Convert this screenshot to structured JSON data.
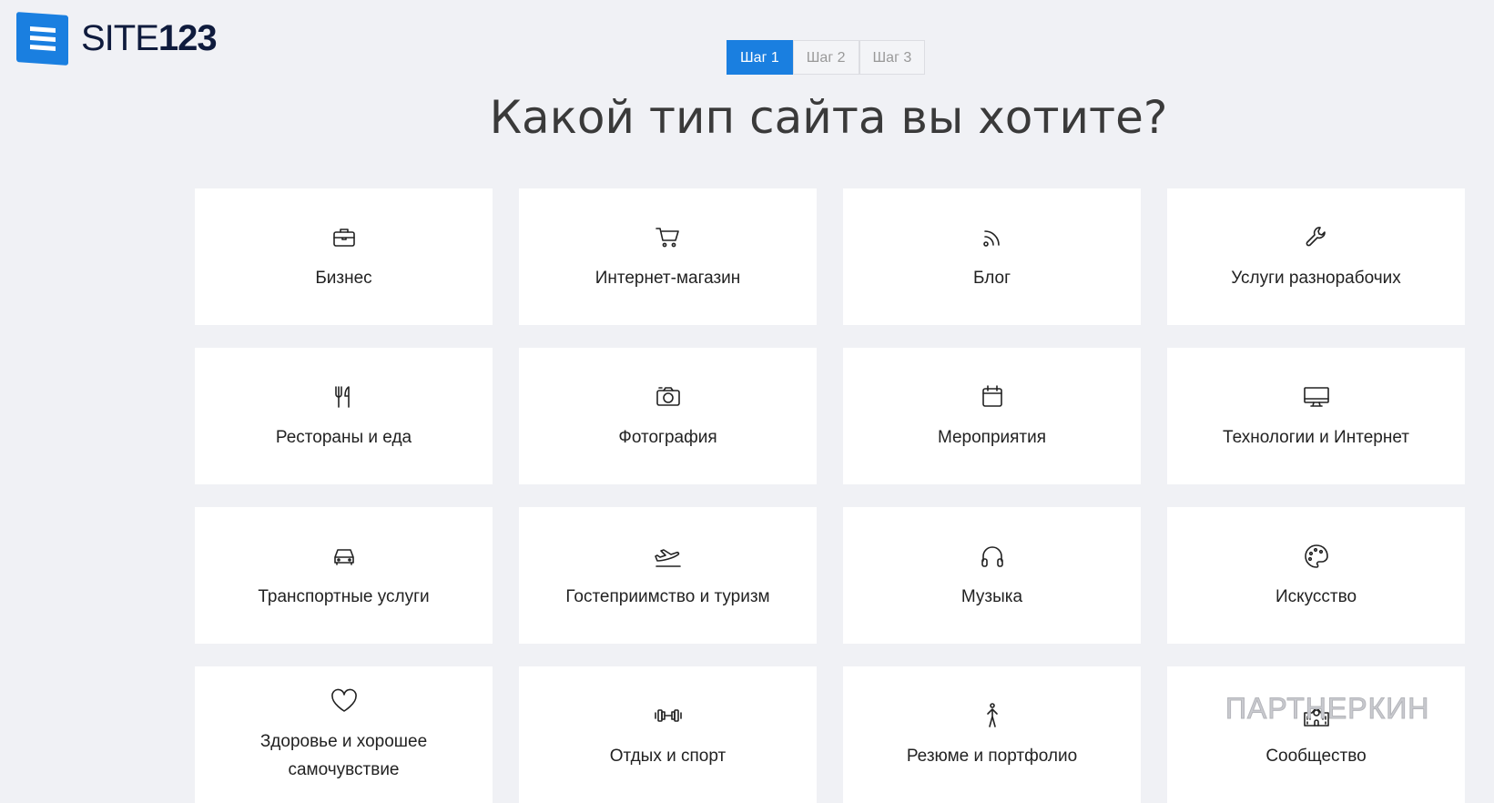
{
  "logo": {
    "text_light": "SITE",
    "text_bold": "123"
  },
  "steps": [
    {
      "label": "Шаг 1",
      "active": true
    },
    {
      "label": "Шаг 2",
      "active": false
    },
    {
      "label": "Шаг 3",
      "active": false
    }
  ],
  "title": "Какой тип сайта вы хотите?",
  "accent": "#1a7fe0",
  "categories": [
    {
      "label": "Бизнес",
      "icon": "briefcase-icon"
    },
    {
      "label": "Интернет-магазин",
      "icon": "cart-icon"
    },
    {
      "label": "Блог",
      "icon": "rss-icon"
    },
    {
      "label": "Услуги разнорабочих",
      "icon": "wrench-icon"
    },
    {
      "label": "Рестораны и еда",
      "icon": "fork-knife-icon"
    },
    {
      "label": "Фотография",
      "icon": "camera-icon"
    },
    {
      "label": "Мероприятия",
      "icon": "calendar-icon"
    },
    {
      "label": "Технологии и Интернет",
      "icon": "monitor-icon"
    },
    {
      "label": "Транспортные услуги",
      "icon": "car-icon"
    },
    {
      "label": "Гостеприимство и туризм",
      "icon": "plane-icon"
    },
    {
      "label": "Музыка",
      "icon": "headphones-icon"
    },
    {
      "label": "Искусство",
      "icon": "palette-icon"
    },
    {
      "label": "Здоровье и хорошее самочувствие",
      "icon": "heart-icon"
    },
    {
      "label": "Отдых и спорт",
      "icon": "dumbbell-icon"
    },
    {
      "label": "Резюме и портфолио",
      "icon": "person-icon"
    },
    {
      "label": "Сообщество",
      "icon": "building-icon"
    }
  ],
  "watermark": "ПАРТНЕРКИН"
}
